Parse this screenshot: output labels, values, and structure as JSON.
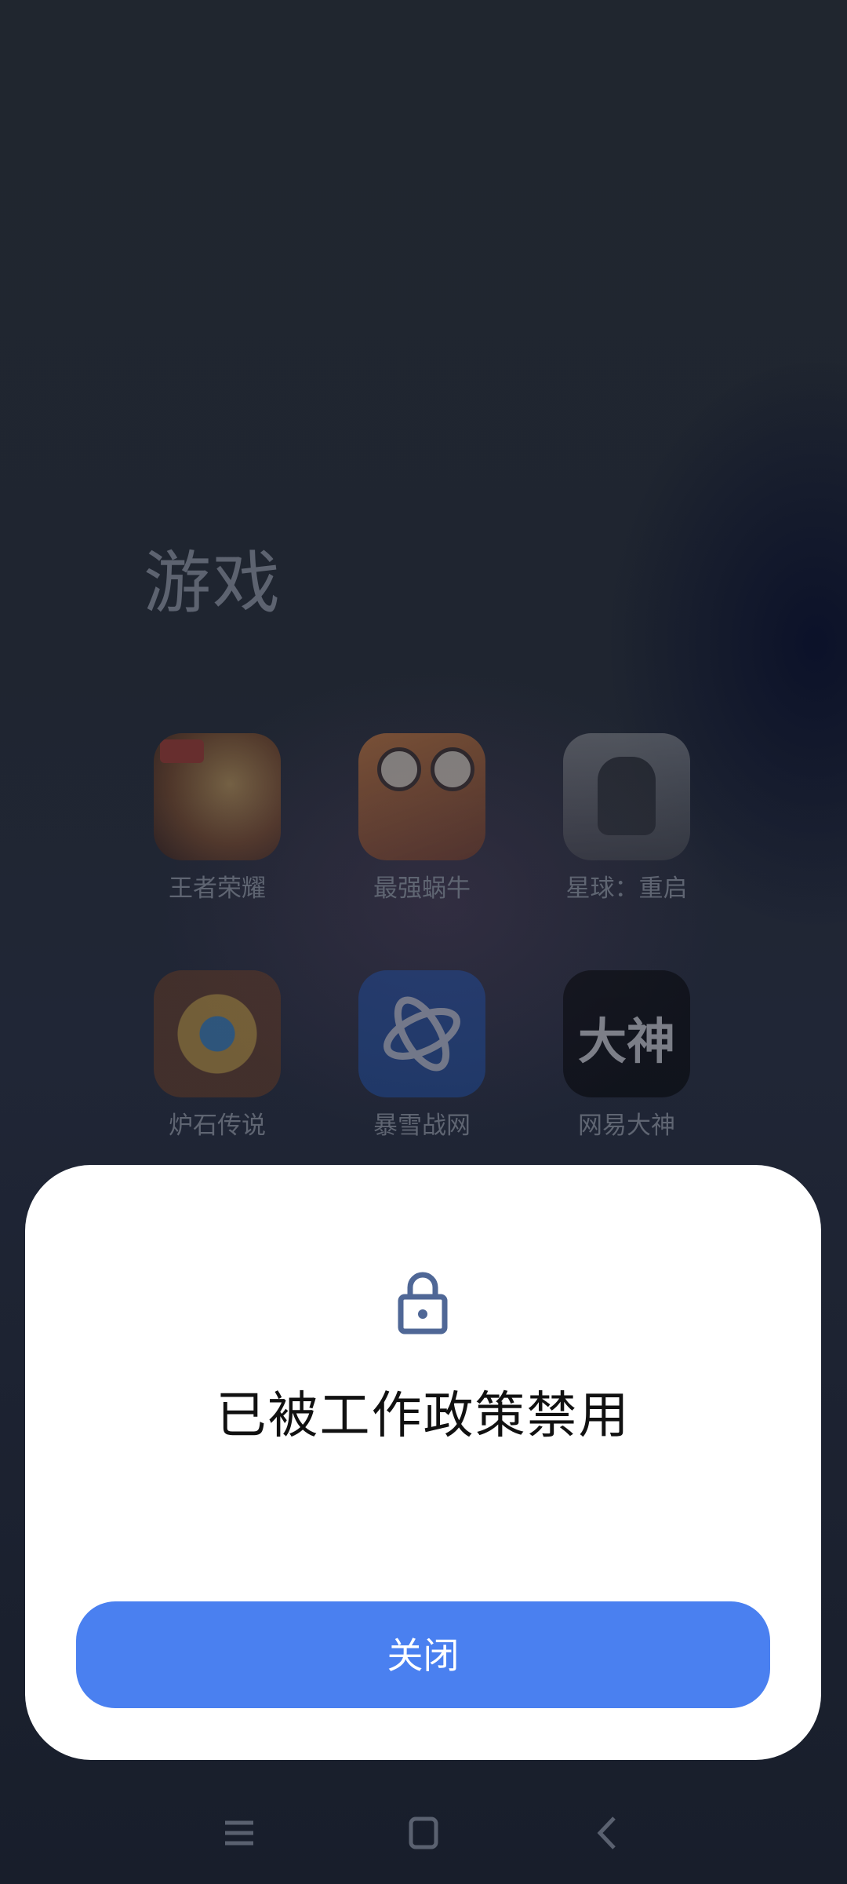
{
  "folder": {
    "title": "游戏",
    "apps": [
      {
        "label": "王者荣耀",
        "icon": "honor-of-kings-icon"
      },
      {
        "label": "最强蜗牛",
        "icon": "snail-game-icon"
      },
      {
        "label": "星球：重启",
        "icon": "planet-restart-icon"
      },
      {
        "label": "炉石传说",
        "icon": "hearthstone-icon"
      },
      {
        "label": "暴雪战网",
        "icon": "battlenet-icon"
      },
      {
        "label": "网易大神",
        "icon": "netease-dashen-icon",
        "icon_text": "大神"
      }
    ]
  },
  "dialog": {
    "icon": "lock-icon",
    "message": "已被工作政策禁用",
    "close_label": "关闭",
    "button_color": "#4a80f0"
  },
  "navbar": {
    "menu_icon": "menu-icon",
    "home_icon": "home-icon",
    "back_icon": "back-icon"
  }
}
